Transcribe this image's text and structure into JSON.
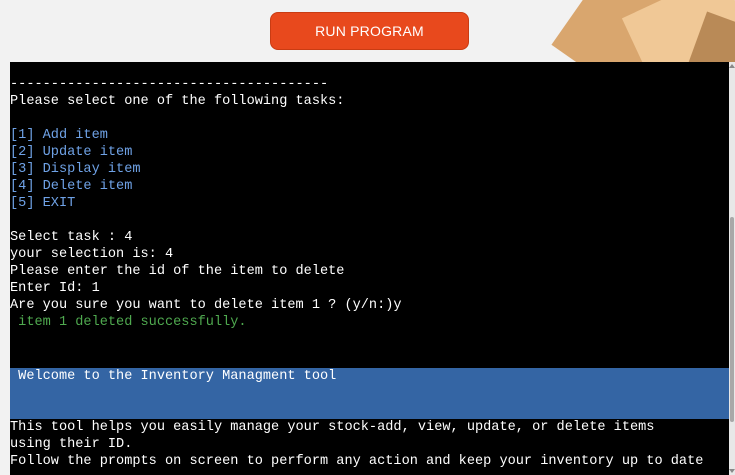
{
  "run_button": {
    "label": "RUN PROGRAM"
  },
  "terminal": {
    "lines": [
      {
        "text": "---------------------------------------"
      },
      {
        "text": "Please select one of the following tasks:"
      },
      {
        "text": ""
      },
      {
        "text": "[1] Add item"
      },
      {
        "text": "[2] Update item"
      },
      {
        "text": "[3] Display item"
      },
      {
        "text": "[4] Delete item"
      },
      {
        "text": "[5] EXIT"
      },
      {
        "text": ""
      },
      {
        "text": "Select task : 4"
      },
      {
        "text": "your selection is: 4"
      },
      {
        "text": "Please enter the id of the item to delete"
      },
      {
        "text": "Enter Id: 1"
      },
      {
        "text": "Are you sure you want to delete item 1 ? (y/n:)y"
      },
      {
        "text": " item 1 deleted successfully."
      }
    ],
    "banner": {
      "text": " Welcome to the Inventory Managment tool"
    },
    "intro": [
      {
        "text": "This tool helps you easily manage your stock-add, view, update, or delete items"
      },
      {
        "text": "using their ID."
      },
      {
        "text": "Follow the prompts on screen to perform any action and keep your inventory up to date"
      }
    ]
  },
  "colors": {
    "run_button": "#e8491d",
    "terminal_bg": "#000000",
    "menu_text": "#6fa2e6",
    "success_text": "#4fa94f",
    "banner_bg": "#3465a4"
  }
}
